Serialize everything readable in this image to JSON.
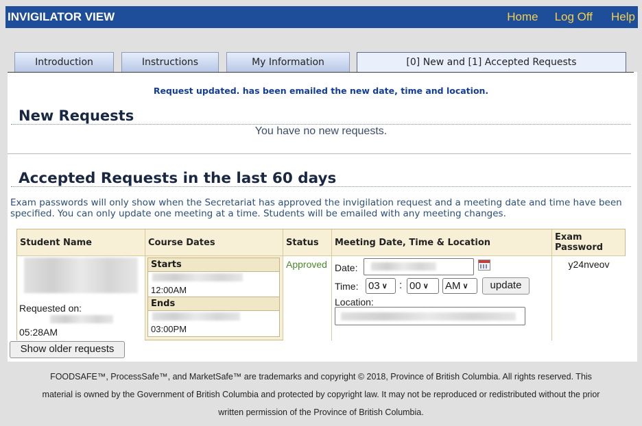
{
  "header": {
    "title": "INVIGILATOR VIEW",
    "links": [
      "Home",
      "Log Off",
      "Help"
    ]
  },
  "tabs": [
    "Introduction",
    "Instructions",
    "My Information",
    "[0] New and [1] Accepted Requests"
  ],
  "message": "Request updated. has been emailed the new date, time and location.",
  "new_requests": {
    "heading": "New Requests",
    "empty_text": "You have no new requests."
  },
  "accepted": {
    "heading": "Accepted Requests in the last 60 days",
    "info": "Exam passwords will only show when the Secretariat has approved the invigilation request and a meeting date and time have been specified. You can only update one meeting at a time. Students will be emailed with any meeting changes.",
    "columns": [
      "Student Name",
      "Course Dates",
      "Status",
      "Meeting Date, Time & Location",
      "Exam Password"
    ],
    "row": {
      "requested_label": "Requested on:",
      "requested_time": "05:28AM",
      "starts_label": "Starts",
      "starts_time": "12:00AM",
      "ends_label": "Ends",
      "ends_time": "03:00PM",
      "status": "Approved",
      "date_label": "Date:",
      "time_label": "Time:",
      "hour": "03",
      "colon": ":",
      "minute": "00",
      "ampm": "AM",
      "update_label": "update",
      "location_label": "Location:",
      "password": "y24nveov"
    },
    "older_button": "Show older requests"
  },
  "footer": [
    "FOODSAFE™, ProcessSafe™, and MarketSafe™ are trademarks and copyright © 2018, Province of British Columbia. All rights reserved. This",
    "material is owned by the Government of British Columbia and protected by copyright law. It may not be reproduced or redistributed without the prior",
    "written permission of the Province of British Columbia."
  ],
  "colors": {
    "header_bg": "#1e4d9a",
    "header_link": "#f5d04a",
    "status_approved": "#4a8a2a",
    "message": "#123c9a"
  }
}
